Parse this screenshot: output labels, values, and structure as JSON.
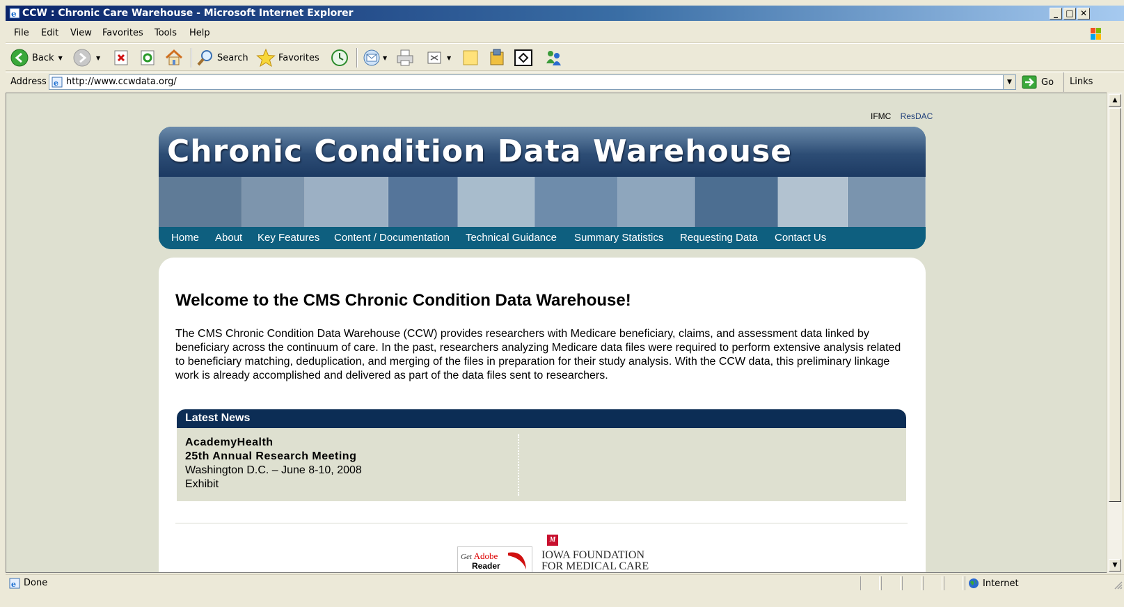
{
  "window": {
    "title": "CCW : Chronic Care Warehouse - Microsoft Internet Explorer",
    "controls": [
      "_",
      "□",
      "✕"
    ]
  },
  "menubar": {
    "items": [
      {
        "label": "File",
        "underline": "F"
      },
      {
        "label": "Edit",
        "underline": "E"
      },
      {
        "label": "View",
        "underline": "V"
      },
      {
        "label": "Favorites",
        "underline": "a"
      },
      {
        "label": "Tools",
        "underline": "T"
      },
      {
        "label": "Help",
        "underline": "H"
      }
    ]
  },
  "toolbar": {
    "back_label": "Back",
    "search_label": "Search",
    "favorites_label": "Favorites"
  },
  "addressbar": {
    "label": "Address",
    "url": "http://www.ccwdata.org/",
    "go_label": "Go",
    "links_label": "Links"
  },
  "page": {
    "top_links": [
      "IFMC",
      "ResDAC"
    ],
    "banner_title": "Chronic Condition Data Warehouse",
    "nav": [
      "Home",
      "About",
      "Key Features",
      "Content / Documentation",
      "Technical Guidance",
      "Summary Statistics",
      "Requesting Data",
      "Contact Us"
    ],
    "welcome_heading": "Welcome to the CMS Chronic Condition Data Warehouse!",
    "intro": "The CMS Chronic Condition Data Warehouse (CCW) provides researchers with Medicare beneficiary, claims, and assessment data linked by beneficiary across the continuum of care. In the past, researchers analyzing Medicare data files were required to perform extensive analysis related to beneficiary matching, deduplication, and merging of the files in preparation for their study analysis. With the CCW data, this preliminary linkage work is already accomplished and delivered as part of the data files sent to researchers.",
    "news": {
      "title": "Latest News",
      "item": {
        "org": "AcademyHealth",
        "event": "25th Annual Research Meeting",
        "location": "Washington D.C. – June 8-10, 2008",
        "type": "Exhibit"
      }
    },
    "footer_logos": {
      "adobe_get": "Get",
      "adobe_brand": "Adobe",
      "adobe_reader": "Reader",
      "ifmc_line1": "IOWA FOUNDATION",
      "ifmc_line2": "FOR MEDICAL CARE"
    }
  },
  "statusbar": {
    "text": "Done",
    "zone": "Internet"
  },
  "colors": {
    "page_background": "#dee0d0",
    "banner_dark": "#1c3a63",
    "nav_teal": "#0e5f7f",
    "news_header": "#0c2d55",
    "link_blue": "#1f3f7a"
  }
}
